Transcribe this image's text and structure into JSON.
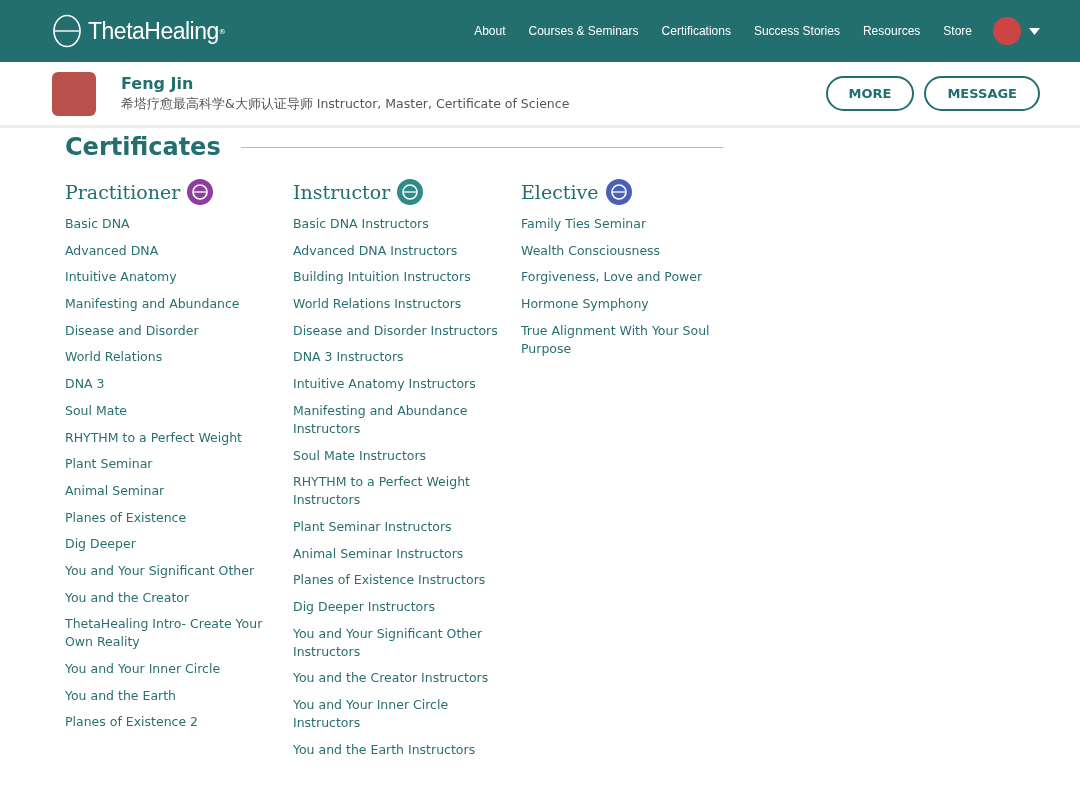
{
  "header": {
    "logo": "ThetaHealing",
    "logo_mark": "®",
    "nav": [
      "About",
      "Courses & Seminars",
      "Certifications",
      "Success Stories",
      "Resources",
      "Store"
    ]
  },
  "profile": {
    "name": "Feng Jin",
    "title": "希塔疗愈最高科学&大师认证导师 Instructor, Master, Certificate of Science",
    "buttons": [
      "MORE",
      "MESSAGE"
    ]
  },
  "section_title": "Certificates",
  "columns": [
    {
      "title": "Practitioner",
      "color": "#8e3f9e",
      "items": [
        "Basic DNA",
        "Advanced DNA",
        "Intuitive Anatomy",
        "Manifesting and Abundance",
        "Disease and Disorder",
        "World Relations",
        "DNA 3",
        "Soul Mate",
        "RHYTHM to a Perfect Weight",
        "Plant Seminar",
        "Animal Seminar",
        "Planes of Existence",
        "Dig Deeper",
        "You and Your Significant Other",
        "You and the Creator",
        "ThetaHealing Intro- Create Your Own Reality",
        "You and Your Inner Circle",
        "You and the Earth",
        "Planes of Existence 2"
      ]
    },
    {
      "title": "Instructor",
      "color": "#2f8a88",
      "items": [
        "Basic DNA Instructors",
        "Advanced DNA Instructors",
        "Building Intuition Instructors",
        "World Relations Instructors",
        "Disease and Disorder Instructors",
        "DNA 3 Instructors",
        "Intuitive Anatomy Instructors",
        "Manifesting and Abundance Instructors",
        "Soul Mate Instructors",
        "RHYTHM to a Perfect Weight Instructors",
        "Plant Seminar Instructors",
        "Animal Seminar Instructors",
        "Planes of Existence Instructors",
        "Dig Deeper Instructors",
        "You and Your Significant Other Instructors",
        "You and the Creator Instructors",
        "You and Your Inner Circle Instructors",
        "You and the Earth Instructors"
      ]
    },
    {
      "title": "Elective",
      "color": "#4a5fb8",
      "items": [
        "Family Ties Seminar",
        "Wealth Consciousness",
        "Forgiveness, Love and Power",
        "Hormone Symphony",
        "True Alignment With Your Soul Purpose"
      ]
    }
  ]
}
